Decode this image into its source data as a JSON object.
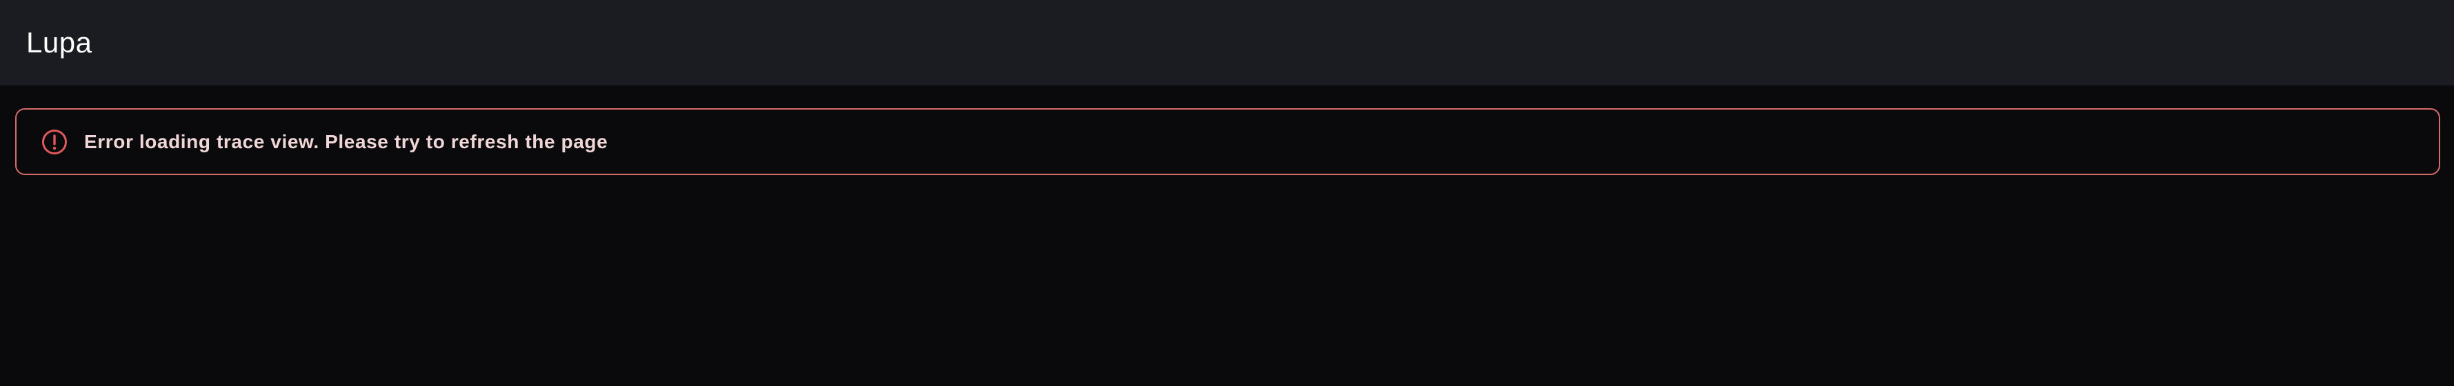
{
  "header": {
    "title": "Lupa"
  },
  "alert": {
    "icon": "alert-circle-icon",
    "message": "Error loading trace view. Please try to refresh the page",
    "border_color": "#d86a6a",
    "icon_color": "#e05a5a",
    "text_color": "#f0d6d6"
  },
  "colors": {
    "header_background": "#1b1c21",
    "page_background": "#0a0a0c"
  }
}
